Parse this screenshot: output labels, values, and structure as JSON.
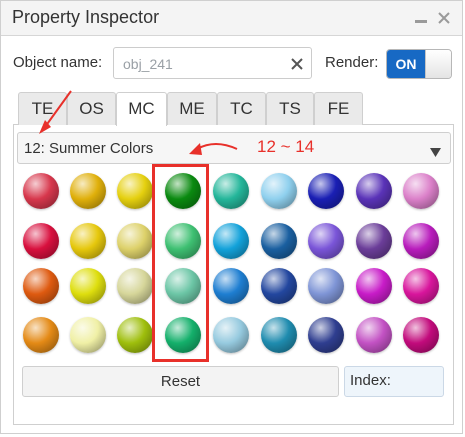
{
  "window": {
    "title": "Property Inspector",
    "minimize_icon": "minimize-icon",
    "close_icon": "close-icon"
  },
  "object": {
    "label": "Object name:",
    "value": "obj_241",
    "clear_icon": "clear-icon"
  },
  "render": {
    "label": "Render:",
    "state": "ON"
  },
  "tabs": [
    {
      "label": "TE",
      "active": false
    },
    {
      "label": "OS",
      "active": false
    },
    {
      "label": "MC",
      "active": true
    },
    {
      "label": "ME",
      "active": false
    },
    {
      "label": "TC",
      "active": false
    },
    {
      "label": "TS",
      "active": false
    },
    {
      "label": "FE",
      "active": false
    }
  ],
  "palette": {
    "selected": "12: Summer Colors",
    "arrow_icon": "dropdown-arrow-icon"
  },
  "swatches": [
    [
      "#d7374c",
      "#e0b00b",
      "#e5d00f",
      "#0a8a10",
      "#24b69a",
      "#8fd0ee",
      "#1a1fb4",
      "#5a33b8",
      "#db80c9"
    ],
    [
      "#d8103e",
      "#e6c80d",
      "#ddd16a",
      "#3ec072",
      "#13a2da",
      "#1a5fa0",
      "#7a55d8",
      "#6b3d99",
      "#b81cbc"
    ],
    [
      "#de5a10",
      "#dede0e",
      "#d6d69a",
      "#6cc6a6",
      "#1e7ed1",
      "#23479f",
      "#7f95d6",
      "#c81cc8",
      "#d8159c"
    ],
    [
      "#e48a16",
      "#f0f0a6",
      "#9fbf0d",
      "#14b06b",
      "#96cadf",
      "#1f8caf",
      "#2f3e90",
      "#c352c4",
      "#c20b7c"
    ]
  ],
  "annotations": {
    "range_text": "12 ~ 14",
    "color": "#e8302a"
  },
  "footer": {
    "reset_label": "Reset",
    "index_label": "Index:"
  }
}
